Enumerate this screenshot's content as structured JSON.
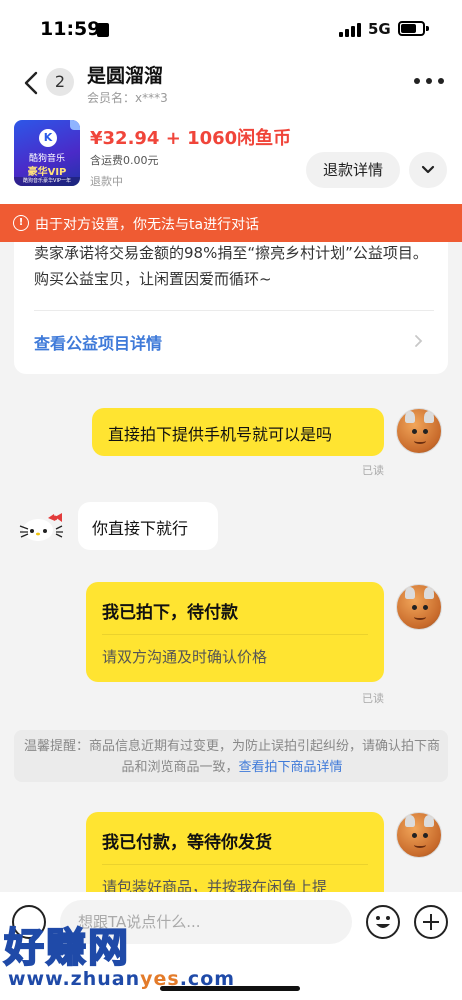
{
  "status_bar": {
    "time": "11:59",
    "network": "5G"
  },
  "header": {
    "back_count": "2",
    "title": "是圆溜溜",
    "member": "会员名：x***3"
  },
  "product": {
    "thumb_app": "酷狗音乐",
    "thumb_vip": "豪华VIP",
    "thumb_strip": "酷狗音乐豪华VIP一年",
    "price": "¥32.94 + 1060闲鱼币",
    "shipping": "含运费0.00元",
    "status": "退款中",
    "refund_button": "退款详情"
  },
  "alert": {
    "text": "由于对方设置，你无法与ta进行对话"
  },
  "charity": {
    "text": "卖家承诺将交易金额的98%捐至“擦亮乡村计划”公益项目。购买公益宝贝，让闲置因爱而循环~",
    "link": "查看公益项目详情"
  },
  "messages": [
    {
      "from": "self",
      "text": "直接拍下提供手机号就可以是吗",
      "read": "已读"
    },
    {
      "from": "other",
      "text": "你直接下就行"
    },
    {
      "from": "self",
      "title": "我已拍下，待付款",
      "subtitle": "请双方沟通及时确认价格",
      "read": "已读"
    },
    {
      "from": "self",
      "title": "我已付款，等待你发货",
      "subtitle": "请包装好商品，并按我在闲鱼上提"
    }
  ],
  "tip": {
    "text": "温馨提醒：商品信息近期有过变更，为防止误拍引起纠纷，请确认拍下商品和浏览商品一致，",
    "link": "查看拍下商品详情"
  },
  "input": {
    "placeholder": "想跟TA说点什么..."
  },
  "watermark": {
    "logo": "好赚网",
    "domain_prefix": "www.zhuan",
    "domain_accent": "yes",
    "domain_suffix": ".com"
  }
}
